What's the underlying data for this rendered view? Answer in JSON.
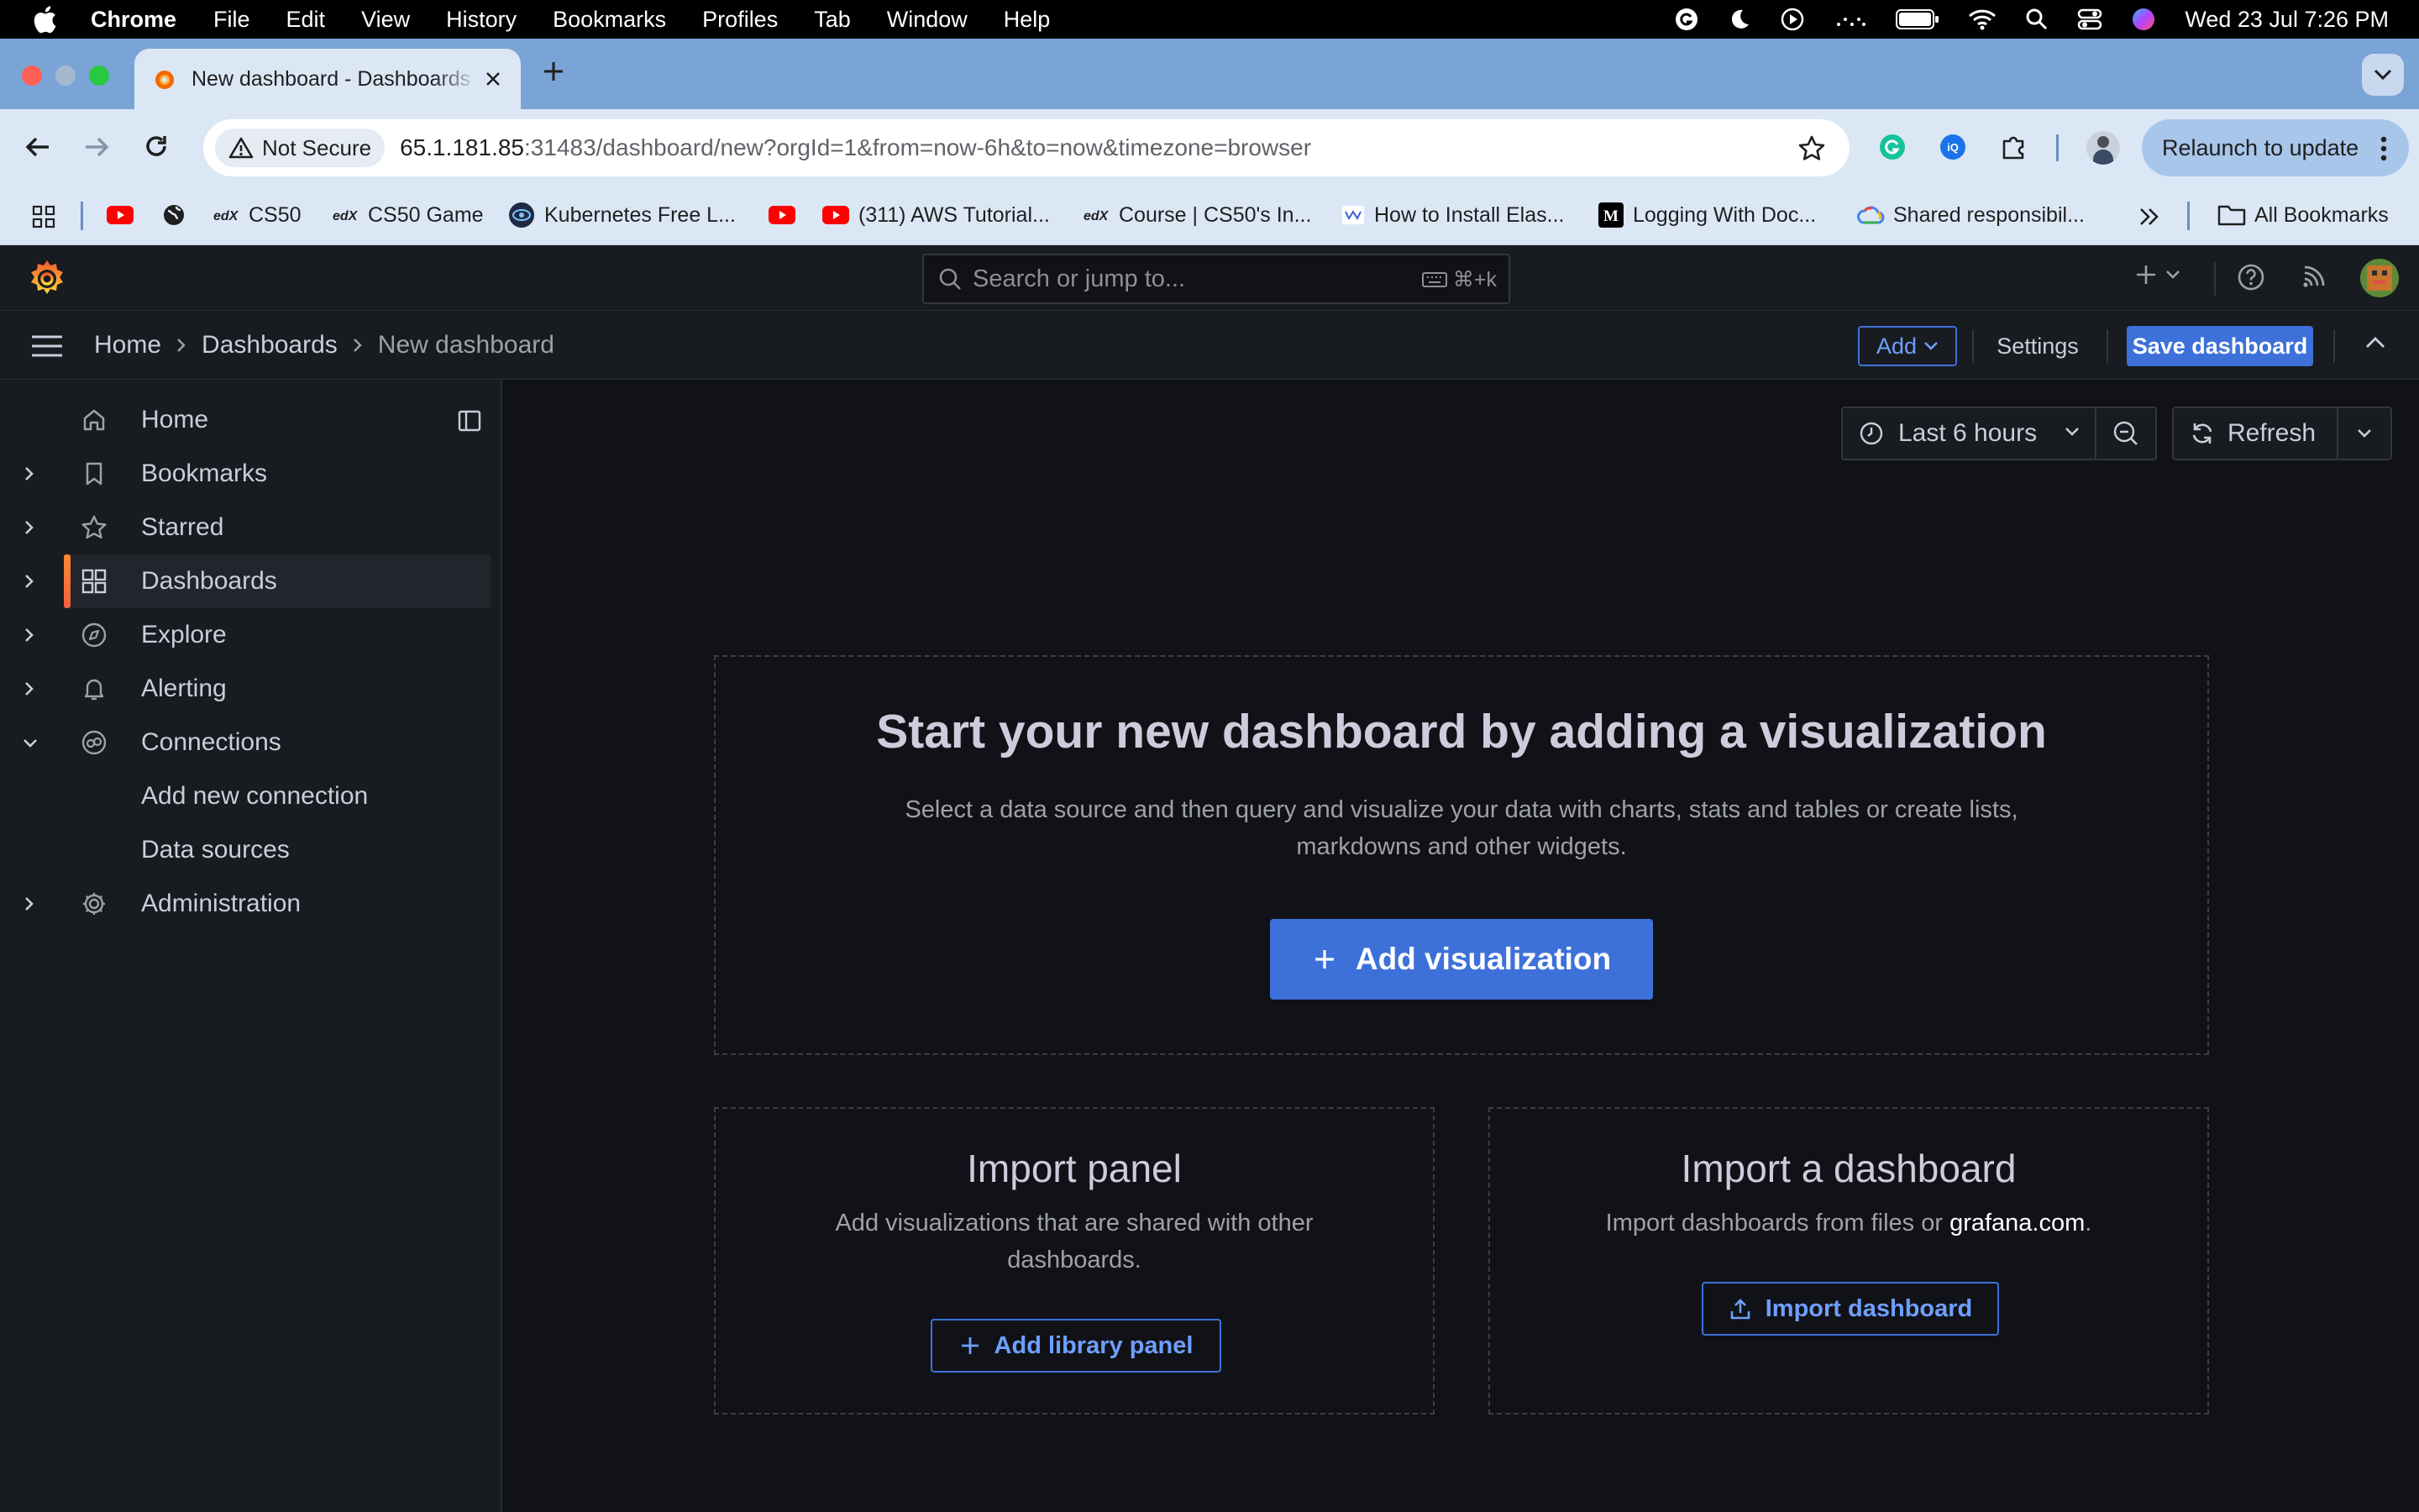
{
  "os_menubar": {
    "app_name": "Chrome",
    "menus": [
      "File",
      "Edit",
      "View",
      "History",
      "Bookmarks",
      "Profiles",
      "Tab",
      "Window",
      "Help"
    ],
    "clock": "Wed 23 Jul  7:26 PM"
  },
  "browser": {
    "tab_title": "New dashboard - Dashboards - Grafana",
    "security_chip": "Not Secure",
    "url_host": "65.1.181.85",
    "url_rest": ":31483/dashboard/new?orgId=1&from=now-6h&to=now&timezone=browser",
    "relaunch_label": "Relaunch to update",
    "bookmarks": [
      {
        "label": "",
        "icon": "youtube-icon"
      },
      {
        "label": "",
        "icon": "globe-icon"
      },
      {
        "label": "CS50",
        "icon": "edx-icon"
      },
      {
        "label": "CS50 Game",
        "icon": "edx-icon"
      },
      {
        "label": "Kubernetes Free L...",
        "icon": "eye-icon"
      },
      {
        "label": "",
        "icon": "youtube-icon"
      },
      {
        "label": "(311) AWS Tutorial...",
        "icon": "youtube-icon"
      },
      {
        "label": "Course | CS50's In...",
        "icon": "edx-icon"
      },
      {
        "label": "How to Install Elas...",
        "icon": "site-icon"
      },
      {
        "label": "Logging With Doc...",
        "icon": "medium-icon"
      },
      {
        "label": "Shared responsibil...",
        "icon": "gcloud-icon"
      }
    ],
    "all_bookmarks_label": "All Bookmarks"
  },
  "grafana": {
    "search": {
      "placeholder": "Search or jump to...",
      "shortcut": "⌘+k"
    },
    "breadcrumbs": [
      "Home",
      "Dashboards",
      "New dashboard"
    ],
    "toolbar": {
      "add_label": "Add",
      "settings_label": "Settings",
      "save_label": "Save dashboard"
    },
    "sidebar": {
      "items": [
        {
          "label": "Home",
          "icon": "home-icon"
        },
        {
          "label": "Bookmarks",
          "icon": "bookmark-icon"
        },
        {
          "label": "Starred",
          "icon": "star-icon"
        },
        {
          "label": "Dashboards",
          "icon": "apps-icon",
          "active": true
        },
        {
          "label": "Explore",
          "icon": "compass-icon"
        },
        {
          "label": "Alerting",
          "icon": "bell-icon"
        },
        {
          "label": "Connections",
          "icon": "connections-icon",
          "expanded": true
        },
        {
          "label": "Administration",
          "icon": "cog-icon"
        }
      ],
      "connections_children": [
        "Add new connection",
        "Data sources"
      ]
    },
    "time_picker": {
      "label": "Last 6 hours",
      "refresh_label": "Refresh"
    },
    "empty_state": {
      "title": "Start your new dashboard by adding a visualization",
      "text_line1": "Select a data source and then query and visualize your data with charts, stats and tables or create lists,",
      "text_line2": "markdowns and other widgets.",
      "button": "Add visualization"
    },
    "import_panel": {
      "title": "Import panel",
      "text_line1": "Add visualizations that are shared with other",
      "text_line2": "dashboards.",
      "button": "Add library panel"
    },
    "import_dashboard": {
      "title": "Import a dashboard",
      "text_before": "Import dashboards from files or ",
      "link": "grafana.com",
      "text_after": ".",
      "button": "Import dashboard"
    },
    "colors": {
      "primary": "#3d71d9",
      "active_bar": "#ff8833",
      "background": "#111217",
      "surface": "#181b1f"
    }
  }
}
